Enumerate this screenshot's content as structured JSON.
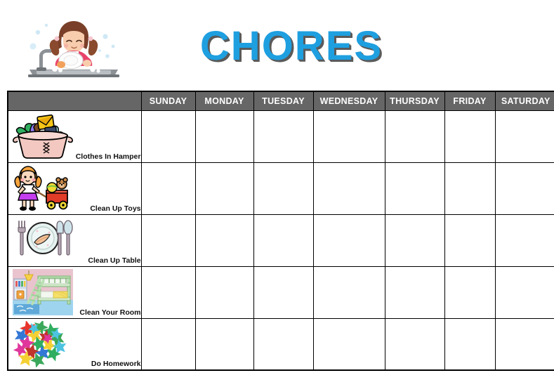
{
  "header": {
    "title": "CHORES",
    "title_color": "#1E9FE0",
    "illustration": "girl-washing-dishes-icon"
  },
  "table": {
    "corner_header": "",
    "header_background": "#666666",
    "header_text_color": "#FFFFFF",
    "day_columns": [
      "SUNDAY",
      "MONDAY",
      "TUESDAY",
      "WEDNESDAY",
      "THURSDAY",
      "FRIDAY",
      "SATURDAY"
    ],
    "rows": [
      {
        "label": "Clothes In Hamper",
        "icon": "laundry-basket-icon",
        "checks": [
          "",
          "",
          "",
          "",
          "",
          "",
          ""
        ]
      },
      {
        "label": "Clean Up Toys",
        "icon": "girl-with-wagon-icon",
        "checks": [
          "",
          "",
          "",
          "",
          "",
          "",
          ""
        ]
      },
      {
        "label": "Clean Up Table",
        "icon": "place-setting-icon",
        "checks": [
          "",
          "",
          "",
          "",
          "",
          "",
          ""
        ]
      },
      {
        "label": "Clean Your Room",
        "icon": "bunk-bed-room-icon",
        "checks": [
          "",
          "",
          "",
          "",
          "",
          "",
          ""
        ]
      },
      {
        "label": "Do Homework",
        "icon": "colorful-stars-icon",
        "checks": [
          "",
          "",
          "",
          "",
          "",
          "",
          ""
        ]
      }
    ]
  }
}
